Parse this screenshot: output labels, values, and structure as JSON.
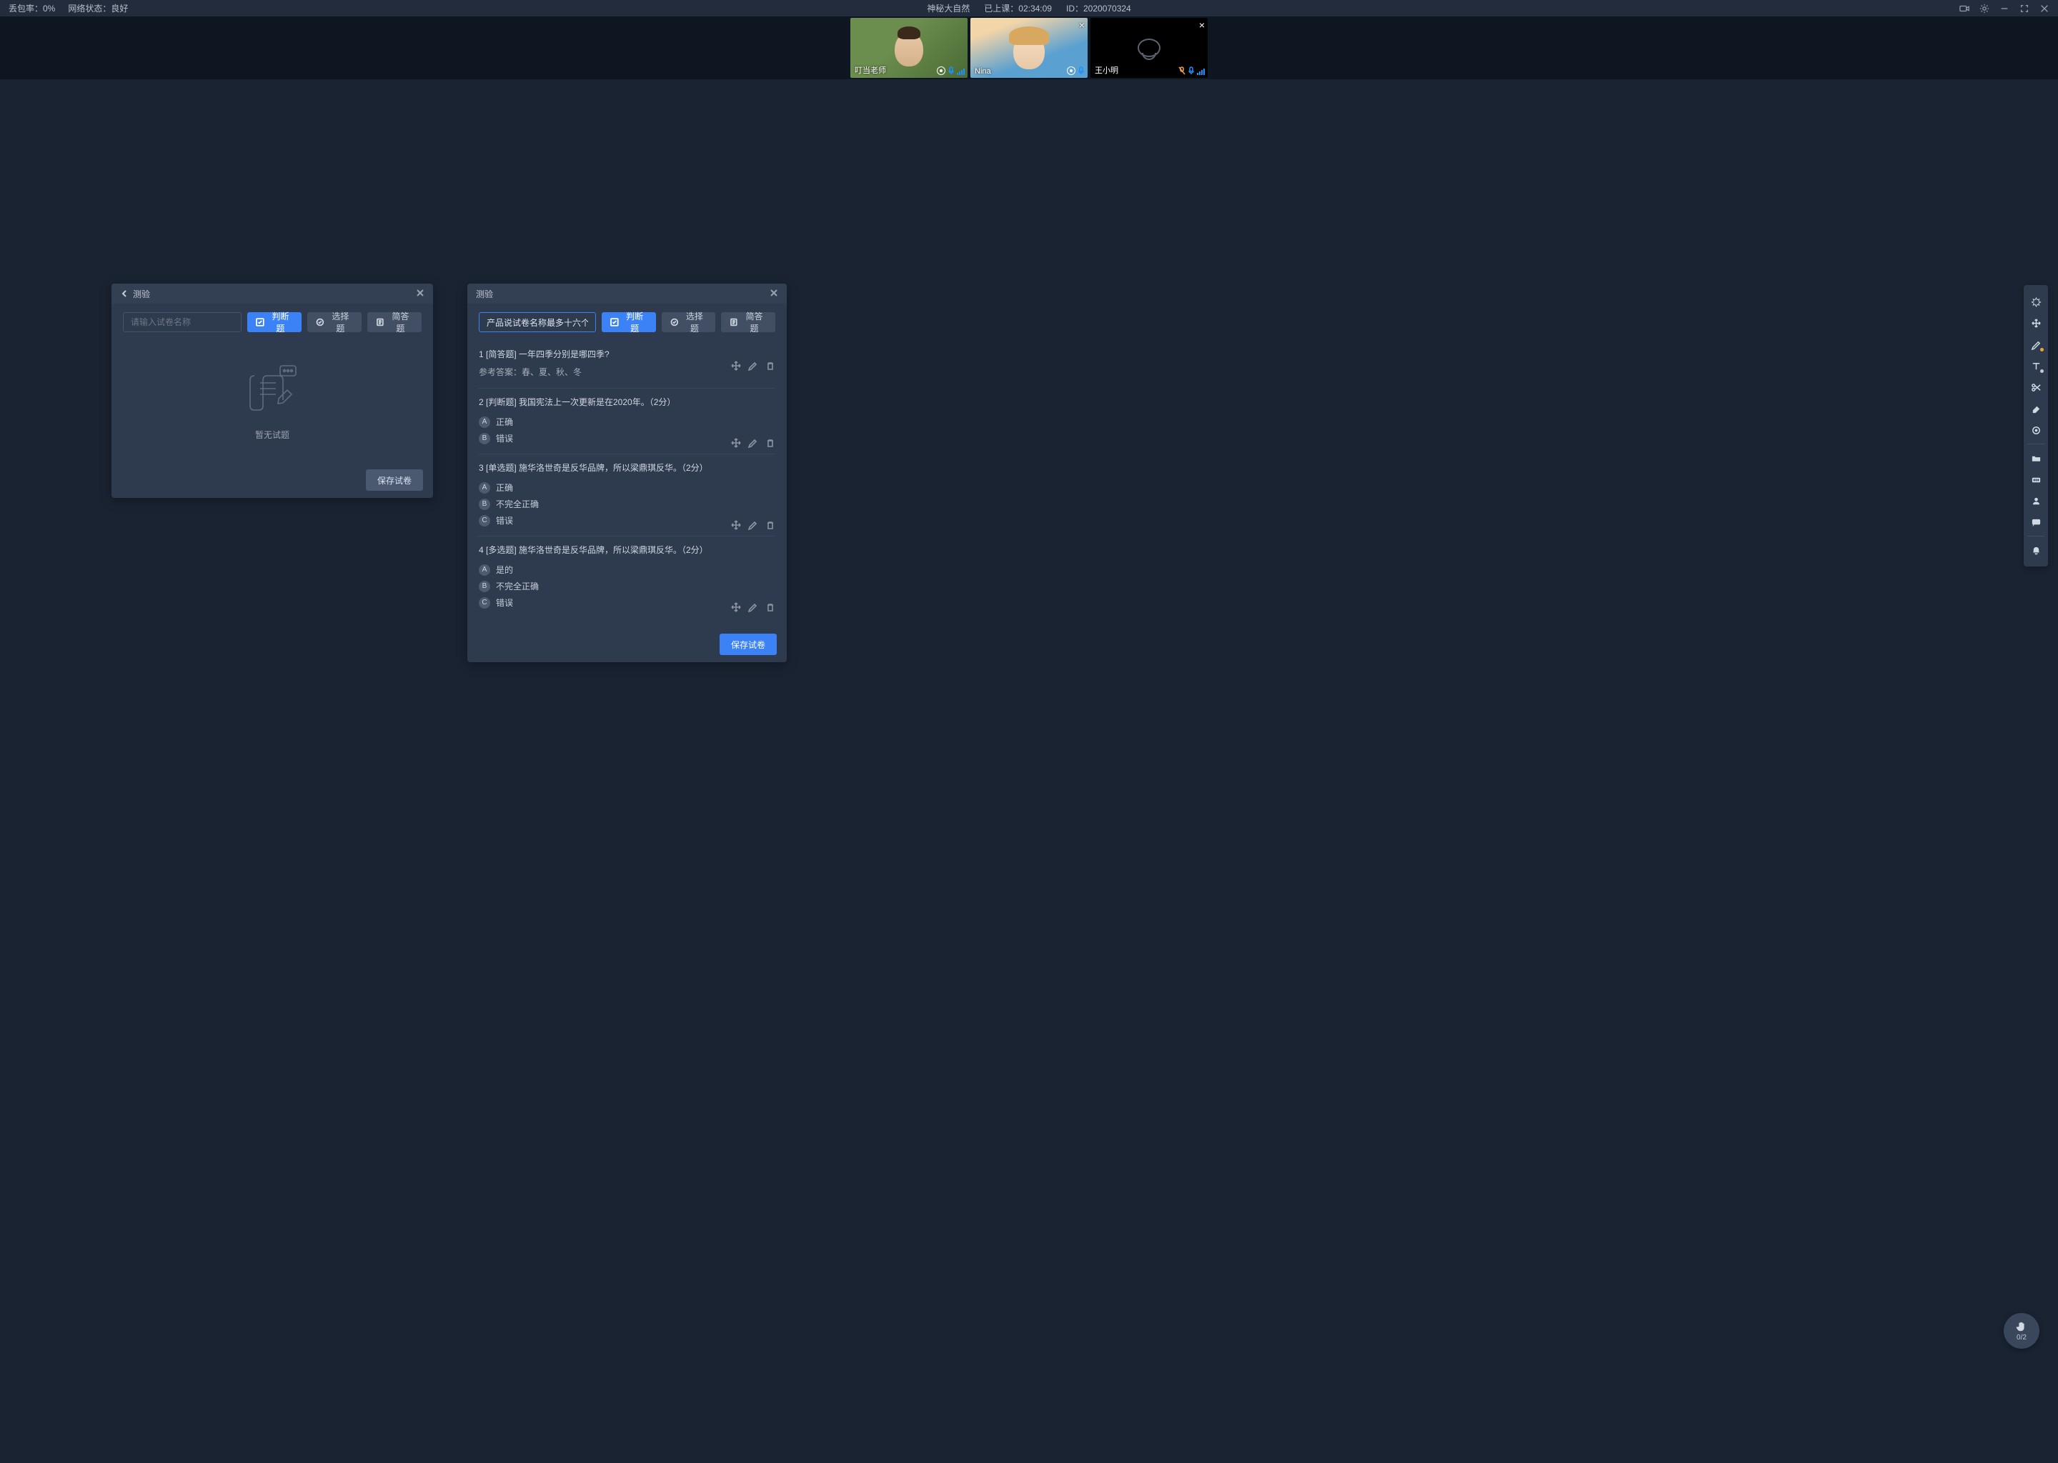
{
  "topbar": {
    "packet_loss_label": "丢包率：0%",
    "network_label": "网络状态：良好",
    "class_title": "神秘大自然",
    "elapsed_label": "已上课：02:34:09",
    "id_label": "ID：2020070324"
  },
  "videos": {
    "tile1_name": "叮当老师",
    "tile2_name": "Nina",
    "tile3_name": "王小明"
  },
  "left_panel": {
    "title": "测验",
    "name_placeholder": "请输入试卷名称",
    "btn_judge": "判断题",
    "btn_choice": "选择题",
    "btn_short": "简答题",
    "empty_text": "暂无试题",
    "save": "保存试卷"
  },
  "right_panel": {
    "title": "测验",
    "name_value": "产品说试卷名称最多十六个字",
    "btn_judge": "判断题",
    "btn_choice": "选择题",
    "btn_short": "简答题",
    "save": "保存试卷",
    "q1_title": "1 [简答题] 一年四季分别是哪四季?",
    "q1_ref": "参考答案：春、夏、秋、冬",
    "q2_title": "2 [判断题] 我国宪法上一次更新是在2020年。（2分）",
    "q2_a": "正确",
    "q2_b": "错误",
    "q3_title": "3 [单选题] 施华洛世奇是反华品牌，所以梁鼎琪反华。（2分）",
    "q3_a": "正确",
    "q3_b": "不完全正确",
    "q3_c": "错误",
    "q4_title": "4 [多选题] 施华洛世奇是反华品牌，所以梁鼎琪反华。（2分）",
    "q4_a": "是的",
    "q4_b": "不完全正确",
    "q4_c": "错误"
  },
  "hand": {
    "count": "0/2"
  },
  "options": {
    "A": "A",
    "B": "B",
    "C": "C"
  }
}
